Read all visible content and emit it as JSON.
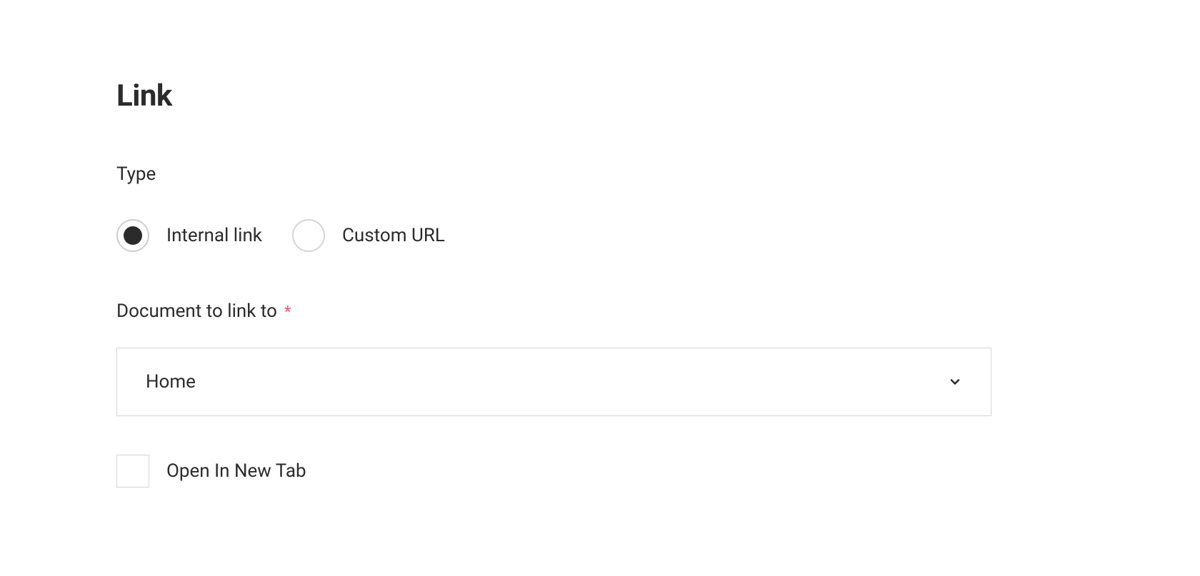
{
  "heading": "Link",
  "type_field": {
    "label": "Type",
    "options": [
      {
        "label": "Internal link",
        "selected": true
      },
      {
        "label": "Custom URL",
        "selected": false
      }
    ]
  },
  "document_field": {
    "label": "Document to link to",
    "required_indicator": "*",
    "selected_value": "Home"
  },
  "open_new_tab": {
    "label": "Open In New Tab",
    "checked": false
  }
}
